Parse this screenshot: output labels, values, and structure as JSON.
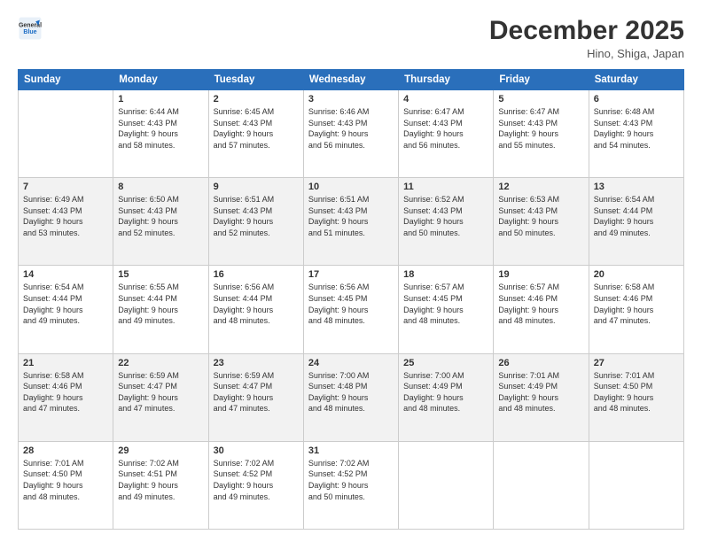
{
  "header": {
    "logo_line1": "General",
    "logo_line2": "Blue",
    "month": "December 2025",
    "location": "Hino, Shiga, Japan"
  },
  "days_of_week": [
    "Sunday",
    "Monday",
    "Tuesday",
    "Wednesday",
    "Thursday",
    "Friday",
    "Saturday"
  ],
  "weeks": [
    [
      {
        "day": "",
        "text": ""
      },
      {
        "day": "1",
        "text": "Sunrise: 6:44 AM\nSunset: 4:43 PM\nDaylight: 9 hours\nand 58 minutes."
      },
      {
        "day": "2",
        "text": "Sunrise: 6:45 AM\nSunset: 4:43 PM\nDaylight: 9 hours\nand 57 minutes."
      },
      {
        "day": "3",
        "text": "Sunrise: 6:46 AM\nSunset: 4:43 PM\nDaylight: 9 hours\nand 56 minutes."
      },
      {
        "day": "4",
        "text": "Sunrise: 6:47 AM\nSunset: 4:43 PM\nDaylight: 9 hours\nand 56 minutes."
      },
      {
        "day": "5",
        "text": "Sunrise: 6:47 AM\nSunset: 4:43 PM\nDaylight: 9 hours\nand 55 minutes."
      },
      {
        "day": "6",
        "text": "Sunrise: 6:48 AM\nSunset: 4:43 PM\nDaylight: 9 hours\nand 54 minutes."
      }
    ],
    [
      {
        "day": "7",
        "text": "Sunrise: 6:49 AM\nSunset: 4:43 PM\nDaylight: 9 hours\nand 53 minutes."
      },
      {
        "day": "8",
        "text": "Sunrise: 6:50 AM\nSunset: 4:43 PM\nDaylight: 9 hours\nand 52 minutes."
      },
      {
        "day": "9",
        "text": "Sunrise: 6:51 AM\nSunset: 4:43 PM\nDaylight: 9 hours\nand 52 minutes."
      },
      {
        "day": "10",
        "text": "Sunrise: 6:51 AM\nSunset: 4:43 PM\nDaylight: 9 hours\nand 51 minutes."
      },
      {
        "day": "11",
        "text": "Sunrise: 6:52 AM\nSunset: 4:43 PM\nDaylight: 9 hours\nand 50 minutes."
      },
      {
        "day": "12",
        "text": "Sunrise: 6:53 AM\nSunset: 4:43 PM\nDaylight: 9 hours\nand 50 minutes."
      },
      {
        "day": "13",
        "text": "Sunrise: 6:54 AM\nSunset: 4:44 PM\nDaylight: 9 hours\nand 49 minutes."
      }
    ],
    [
      {
        "day": "14",
        "text": "Sunrise: 6:54 AM\nSunset: 4:44 PM\nDaylight: 9 hours\nand 49 minutes."
      },
      {
        "day": "15",
        "text": "Sunrise: 6:55 AM\nSunset: 4:44 PM\nDaylight: 9 hours\nand 49 minutes."
      },
      {
        "day": "16",
        "text": "Sunrise: 6:56 AM\nSunset: 4:44 PM\nDaylight: 9 hours\nand 48 minutes."
      },
      {
        "day": "17",
        "text": "Sunrise: 6:56 AM\nSunset: 4:45 PM\nDaylight: 9 hours\nand 48 minutes."
      },
      {
        "day": "18",
        "text": "Sunrise: 6:57 AM\nSunset: 4:45 PM\nDaylight: 9 hours\nand 48 minutes."
      },
      {
        "day": "19",
        "text": "Sunrise: 6:57 AM\nSunset: 4:46 PM\nDaylight: 9 hours\nand 48 minutes."
      },
      {
        "day": "20",
        "text": "Sunrise: 6:58 AM\nSunset: 4:46 PM\nDaylight: 9 hours\nand 47 minutes."
      }
    ],
    [
      {
        "day": "21",
        "text": "Sunrise: 6:58 AM\nSunset: 4:46 PM\nDaylight: 9 hours\nand 47 minutes."
      },
      {
        "day": "22",
        "text": "Sunrise: 6:59 AM\nSunset: 4:47 PM\nDaylight: 9 hours\nand 47 minutes."
      },
      {
        "day": "23",
        "text": "Sunrise: 6:59 AM\nSunset: 4:47 PM\nDaylight: 9 hours\nand 47 minutes."
      },
      {
        "day": "24",
        "text": "Sunrise: 7:00 AM\nSunset: 4:48 PM\nDaylight: 9 hours\nand 48 minutes."
      },
      {
        "day": "25",
        "text": "Sunrise: 7:00 AM\nSunset: 4:49 PM\nDaylight: 9 hours\nand 48 minutes."
      },
      {
        "day": "26",
        "text": "Sunrise: 7:01 AM\nSunset: 4:49 PM\nDaylight: 9 hours\nand 48 minutes."
      },
      {
        "day": "27",
        "text": "Sunrise: 7:01 AM\nSunset: 4:50 PM\nDaylight: 9 hours\nand 48 minutes."
      }
    ],
    [
      {
        "day": "28",
        "text": "Sunrise: 7:01 AM\nSunset: 4:50 PM\nDaylight: 9 hours\nand 48 minutes."
      },
      {
        "day": "29",
        "text": "Sunrise: 7:02 AM\nSunset: 4:51 PM\nDaylight: 9 hours\nand 49 minutes."
      },
      {
        "day": "30",
        "text": "Sunrise: 7:02 AM\nSunset: 4:52 PM\nDaylight: 9 hours\nand 49 minutes."
      },
      {
        "day": "31",
        "text": "Sunrise: 7:02 AM\nSunset: 4:52 PM\nDaylight: 9 hours\nand 50 minutes."
      },
      {
        "day": "",
        "text": ""
      },
      {
        "day": "",
        "text": ""
      },
      {
        "day": "",
        "text": ""
      }
    ]
  ]
}
